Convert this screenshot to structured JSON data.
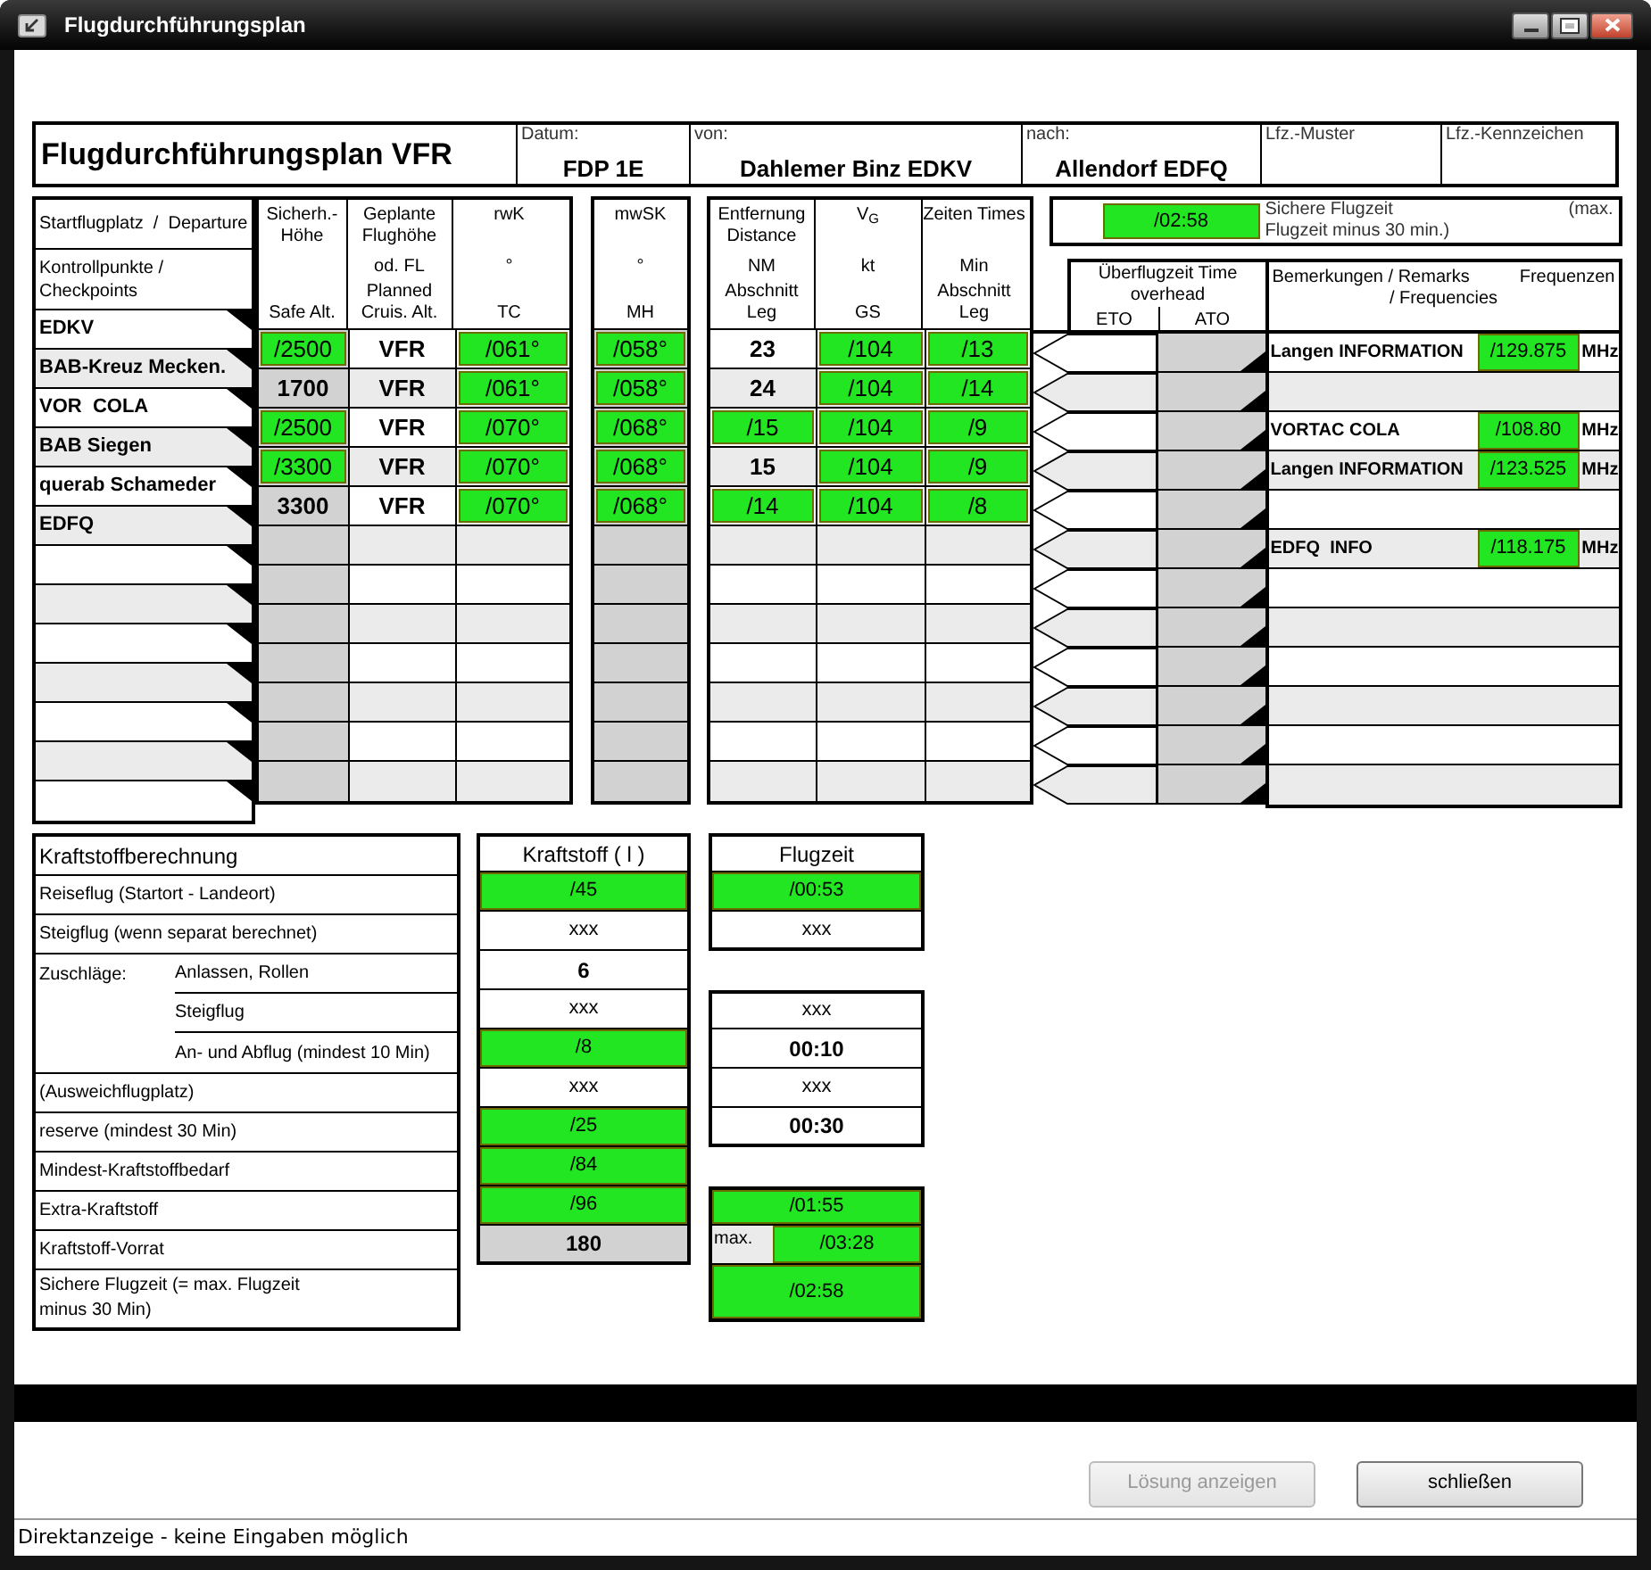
{
  "window": {
    "title": "Flugdurchführungsplan"
  },
  "header": {
    "title": "Flugdurchführungsplan VFR",
    "fields": [
      {
        "label": "Datum:",
        "value": "FDP 1E"
      },
      {
        "label": "von:",
        "value": "Dahlemer Binz  EDKV"
      },
      {
        "label": "nach:",
        "value": "Allendorf EDFQ"
      },
      {
        "label": "Lfz.-Muster"
      },
      {
        "label": "Lfz.-Kennzeichen"
      }
    ]
  },
  "route": {
    "departure_title": "Startflugplatz  /  Departure",
    "checkpoints_title": "Kontrollpunkte / Checkpoints",
    "checkpoints": [
      "EDKV",
      "BAB-Kreuz Mecken.",
      "VOR  COLA",
      "BAB Siegen",
      "querab Schameder",
      "EDFQ"
    ]
  },
  "legs": {
    "groups": [
      {
        "columns": [
          {
            "top": "Sicherh.- Höhe",
            "bottom": "Safe Alt.",
            "shaded": true
          },
          {
            "top": "Geplante Flughöhe",
            "middle": "od. FL",
            "bottom": "Planned Cruis. Alt.",
            "shaded": false
          },
          {
            "top": "rwK",
            "middle": "°",
            "bottom": "TC",
            "shaded": false
          }
        ]
      },
      {
        "columns": [
          {
            "top": "mwSK",
            "middle": "°",
            "bottom": "MH",
            "shaded": true
          }
        ]
      },
      {
        "columns": [
          {
            "top": "Entfernung Distance",
            "middle": "NM",
            "bottom": "Abschnitt Leg",
            "shaded": false
          },
          {
            "top": "V$_{G}$",
            "middle": "kt",
            "bottom": "GS",
            "shaded": false
          },
          {
            "top": "Zeiten Times",
            "middle": "Min",
            "bottom": "Abschnitt Leg",
            "shaded": false
          }
        ]
      }
    ],
    "rows": [
      {
        "cells": [
          {
            "kind": "input",
            "text": "/2500"
          },
          {
            "kind": "fixed",
            "text": "VFR"
          },
          {
            "kind": "input",
            "text": "/061°"
          },
          {
            "kind": "input",
            "text": "/058°"
          },
          {
            "kind": "fixed",
            "text": "23"
          },
          {
            "kind": "input",
            "text": "/104"
          },
          {
            "kind": "input",
            "text": "/13"
          }
        ]
      },
      {
        "cells": [
          {
            "kind": "fixed",
            "text": "1700"
          },
          {
            "kind": "fixed",
            "text": "VFR"
          },
          {
            "kind": "input",
            "text": "/061°"
          },
          {
            "kind": "input",
            "text": "/058°"
          },
          {
            "kind": "fixed",
            "text": "24"
          },
          {
            "kind": "input",
            "text": "/104"
          },
          {
            "kind": "input",
            "text": "/14"
          }
        ]
      },
      {
        "cells": [
          {
            "kind": "input",
            "text": "/2500"
          },
          {
            "kind": "fixed",
            "text": "VFR"
          },
          {
            "kind": "input",
            "text": "/070°"
          },
          {
            "kind": "input",
            "text": "/068°"
          },
          {
            "kind": "input",
            "text": "/15"
          },
          {
            "kind": "input",
            "text": "/104"
          },
          {
            "kind": "input",
            "text": "/9"
          }
        ]
      },
      {
        "cells": [
          {
            "kind": "input",
            "text": "/3300"
          },
          {
            "kind": "fixed",
            "text": "VFR"
          },
          {
            "kind": "input",
            "text": "/070°"
          },
          {
            "kind": "input",
            "text": "/068°"
          },
          {
            "kind": "fixed",
            "text": "15"
          },
          {
            "kind": "input",
            "text": "/104"
          },
          {
            "kind": "input",
            "text": "/9"
          }
        ]
      },
      {
        "cells": [
          {
            "kind": "fixed",
            "text": "3300"
          },
          {
            "kind": "fixed",
            "text": "VFR"
          },
          {
            "kind": "input",
            "text": "/070°"
          },
          {
            "kind": "input",
            "text": "/068°"
          },
          {
            "kind": "input",
            "text": "/14"
          },
          {
            "kind": "input",
            "text": "/104"
          },
          {
            "kind": "input",
            "text": "/8"
          }
        ]
      }
    ]
  },
  "safe_time": {
    "value": "/02:58",
    "label": "Sichere Flugzeit",
    "aside": "(max.",
    "continuation": "Flugzeit minus 30 min.)"
  },
  "overflight": {
    "title": "Überflugzeit Time overhead",
    "columns": [
      "ETO",
      "ATO"
    ]
  },
  "remarks": {
    "title": "Bemerkungen / Remarks",
    "frequency_title": "Frequenzen",
    "subtitle": "/ Frequencies",
    "rows": [
      {
        "label": "Langen INFORMATION",
        "frequency": "/129.875",
        "unit": "MHz"
      },
      null,
      {
        "label": "VORTAC COLA",
        "frequency": "/108.80",
        "unit": "MHz"
      },
      {
        "label": "Langen INFORMATION",
        "frequency": "/123.525",
        "unit": "MHz"
      },
      null,
      {
        "label": "EDFQ  INFO",
        "frequency": "/118.175",
        "unit": "MHz"
      }
    ]
  },
  "fuel": {
    "title": "Kraftstoffberechnung",
    "fuel_title": "Kraftstoff ( l )",
    "time_title": "Flugzeit",
    "rows": [
      {
        "label": "Reiseflug (Startort - Landeort)",
        "fuel": {
          "kind": "input",
          "text": "/45"
        },
        "time": {
          "kind": "input",
          "text": "/00:53"
        }
      },
      {
        "label": "Steigflug (wenn separat berechnet)",
        "fuel": {
          "kind": "plain",
          "text": "xxx"
        },
        "time": {
          "kind": "plain",
          "text": "xxx"
        }
      },
      {
        "group": "Zuschläge:",
        "items": [
          {
            "label": "Anlassen, Rollen",
            "fuel": {
              "kind": "bold",
              "text": "6"
            }
          },
          {
            "label": "Steigflug",
            "fuel": {
              "kind": "plain",
              "text": "xxx"
            },
            "time": {
              "kind": "plain",
              "text": "xxx"
            }
          },
          {
            "label": "An- und Abflug (mindest 10 Min)",
            "fuel": {
              "kind": "input",
              "text": "/8"
            },
            "time": {
              "kind": "bold",
              "text": "00:10"
            }
          }
        ]
      },
      {
        "label": "(Ausweichflugplatz)",
        "fuel": {
          "kind": "plain",
          "text": "xxx"
        },
        "time": {
          "kind": "plain",
          "text": "xxx"
        }
      },
      {
        "label": "reserve (mindest 30 Min)",
        "fuel": {
          "kind": "input",
          "text": "/25"
        },
        "time": {
          "kind": "bold",
          "text": "00:30"
        }
      },
      {
        "label": "Mindest-Kraftstoffbedarf",
        "fuel": {
          "kind": "input",
          "text": "/84"
        }
      },
      {
        "label": "Extra-Kraftstoff",
        "fuel": {
          "kind": "input",
          "text": "/96"
        },
        "time": {
          "kind": "input",
          "text": "/01:55"
        }
      },
      {
        "label": "Kraftstoff-Vorrat",
        "fuel": {
          "kind": "total",
          "text": "180"
        },
        "time": {
          "kind": "input",
          "text": "/03:28",
          "prefix": "max."
        }
      },
      {
        "label": "Sichere Flugzeit (= max. Flugzeit minus 30 Min)",
        "time": {
          "kind": "input",
          "text": "/02:58"
        }
      }
    ]
  },
  "buttons": [
    {
      "label": "Lösung anzeigen",
      "disabled": true
    },
    {
      "label": "schließen",
      "disabled": false
    }
  ],
  "status_bar": "Direktanzeige - keine Eingaben möglich"
}
